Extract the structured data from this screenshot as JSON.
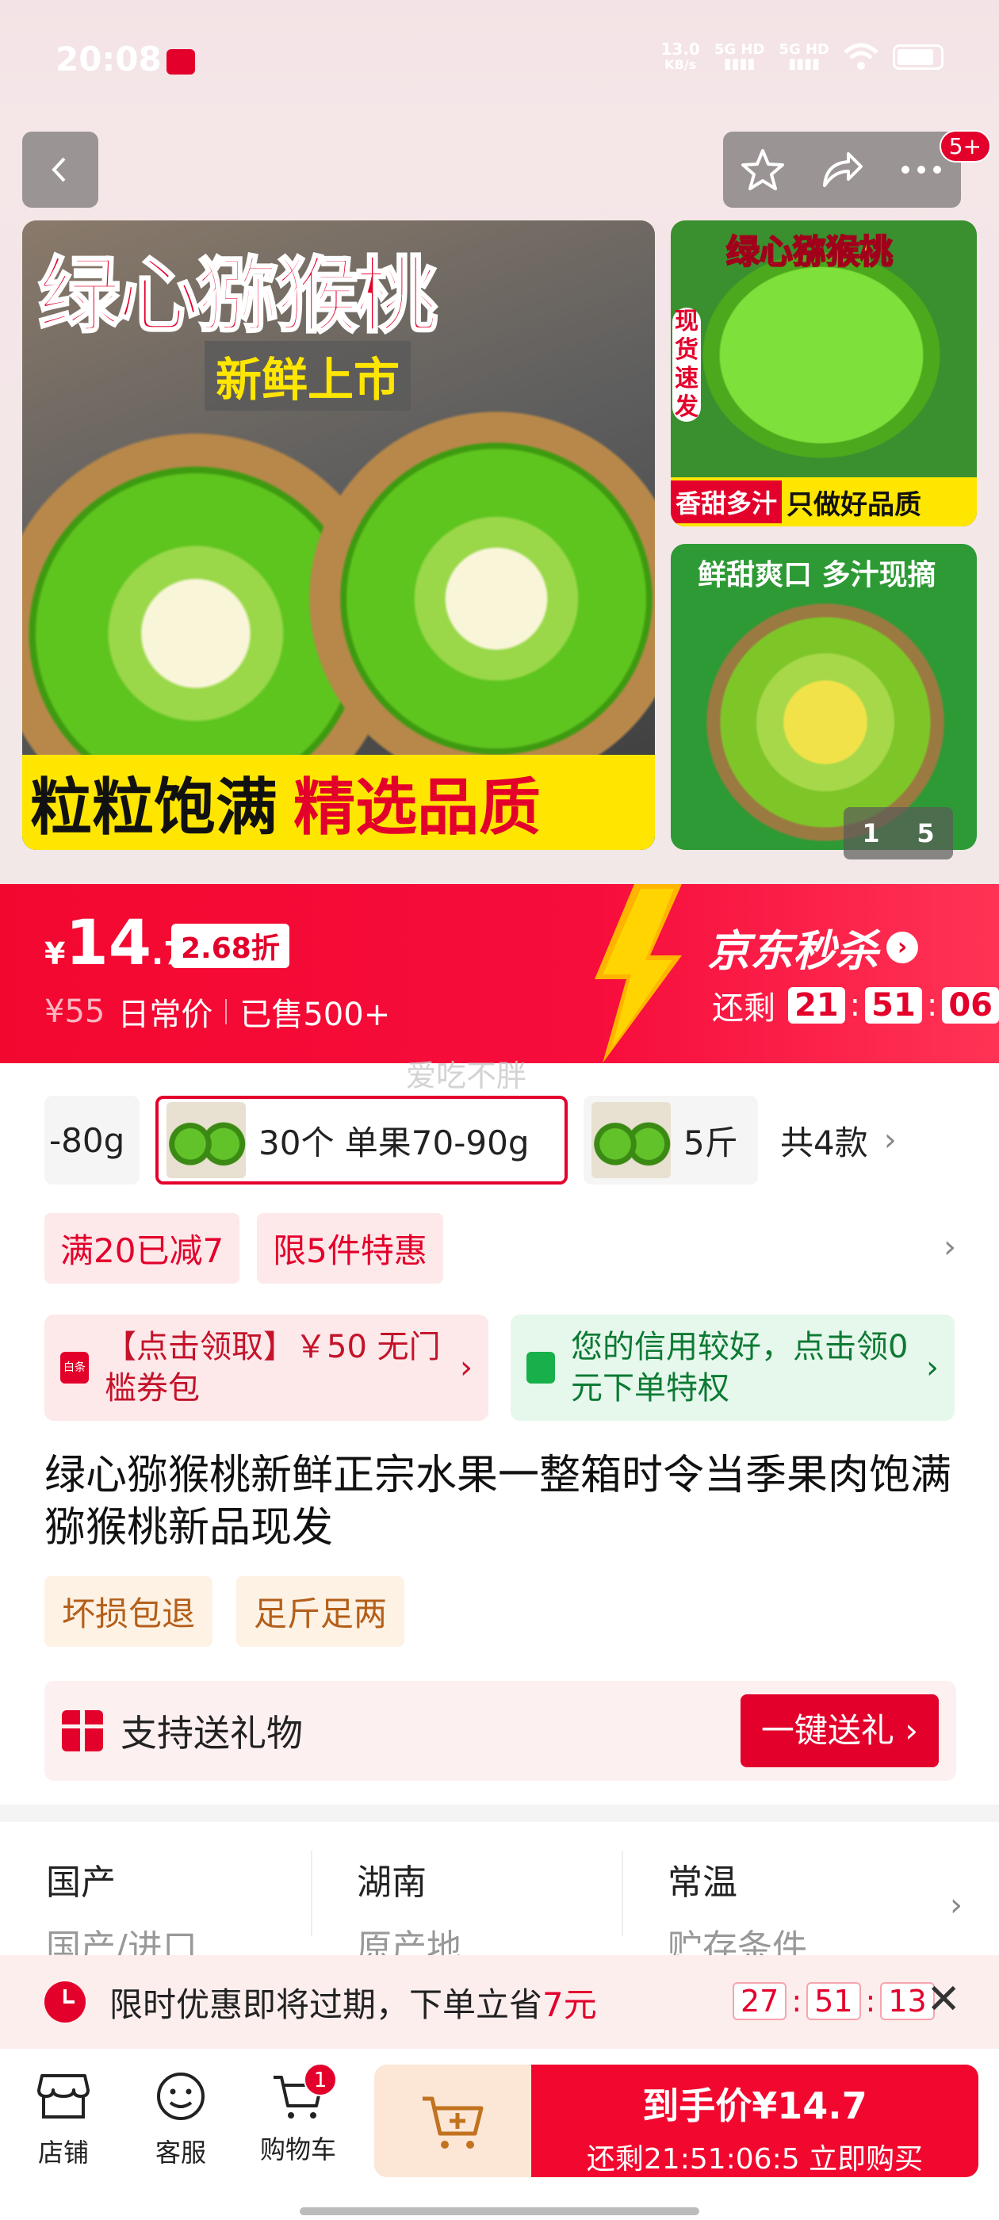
{
  "status_bar": {
    "time": "20:08",
    "app_badge": "小红书",
    "speed_value": "13.0",
    "speed_unit": "KB/s",
    "sig1": "5G HD",
    "sig2": "5G HD"
  },
  "header": {
    "more_badge": "5+"
  },
  "gallery": {
    "main_title": "绿心猕猴桃",
    "main_subtitle": "新鲜上市",
    "main_bottom_left": "粒粒饱满",
    "main_bottom_right": "精选品质",
    "side1_title": "绿心猕猴桃",
    "side1_vertical": "现货速发",
    "side1_bottom_left": "香甜多汁",
    "side1_bottom_right": "只做好品质",
    "side2_title": "鲜甜爽口 多汁现摘",
    "page_current": "1",
    "page_total": "5"
  },
  "price": {
    "yen": "¥",
    "int": "14",
    "dec": ".7",
    "discount": "2.68折",
    "original": "¥55",
    "original_label": "日常价",
    "sold": "已售500+",
    "flash_title": "京东秒杀",
    "remaining_label": "还剩",
    "cd_h": "21",
    "cd_m": "51",
    "cd_s": "06"
  },
  "watermark": "爱吃不胖",
  "variants": {
    "partial_left": "-80g",
    "selected_label": "30个 单果70-90g",
    "next_label": "5斤 ",
    "count": "共4款"
  },
  "promos": [
    "满20已减7",
    "限5件特惠"
  ],
  "coupons": {
    "left": "【点击领取】￥50 无门槛券包",
    "left_icon_text": "白条",
    "right": "您的信用较好，点击领0元下单特权"
  },
  "product_title": "绿心猕猴桃新鲜正宗水果一整箱时令当季果肉饱满猕猴桃新品现发",
  "tags": [
    "坏损包退",
    "足斤足两"
  ],
  "gift": {
    "label": "支持送礼物",
    "button": "一键送礼 ›"
  },
  "specs": [
    {
      "value": "国产",
      "key": "国产/进口"
    },
    {
      "value": "湖南",
      "key": "原产地"
    },
    {
      "value": "常温",
      "key": "贮存条件"
    }
  ],
  "notice": {
    "text_before": "限时优惠即将过期，下单立省",
    "highlight": "7元",
    "cd_h": "27",
    "cd_m": "51",
    "cd_s": "13"
  },
  "bottom_nav": {
    "store": "店铺",
    "service": "客服",
    "cart": "购物车",
    "cart_badge": "1",
    "buy_price": "到手价¥14.7",
    "buy_sub": "还剩21:51:06:5 立即购买"
  },
  "colors": {
    "brand_red": "#e3002b",
    "yellow": "#ffe600"
  }
}
